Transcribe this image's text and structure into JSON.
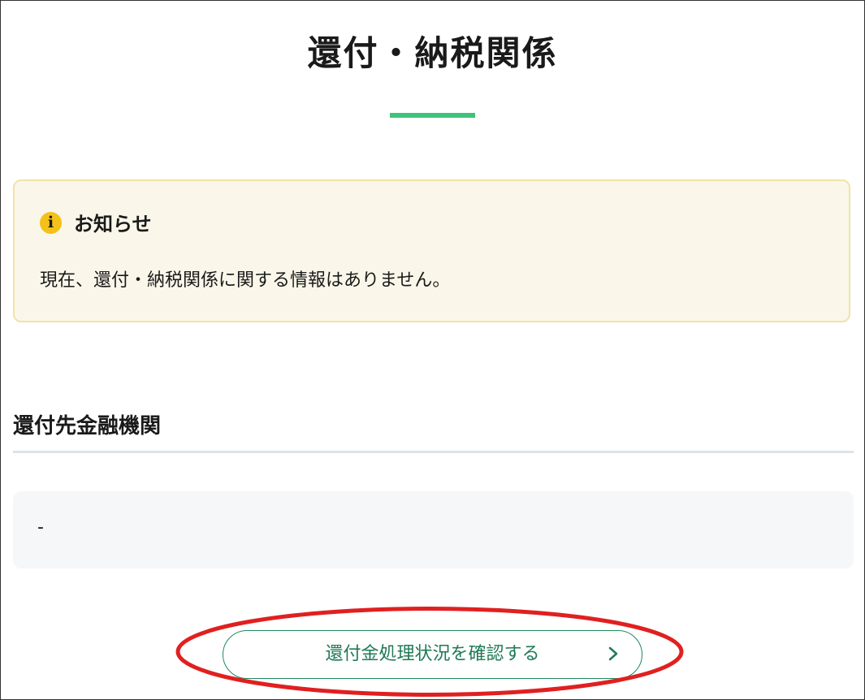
{
  "page": {
    "title": "還付・納税関係"
  },
  "notice": {
    "icon": "info-icon",
    "heading": "お知らせ",
    "message": "現在、還付・納税関係に関する情報はありません。"
  },
  "refund_bank": {
    "heading": "還付先金融機関",
    "value": "-"
  },
  "action": {
    "label": "還付金処理状況を確認する",
    "icon": "chevron-right-icon"
  },
  "colors": {
    "accent_green": "#3ec47a",
    "button_green": "#1f8a5e",
    "notice_bg": "#faf7ea",
    "notice_border": "#f1e3a6",
    "info_yellow": "#f4c118",
    "annotation_red": "#e02020"
  }
}
